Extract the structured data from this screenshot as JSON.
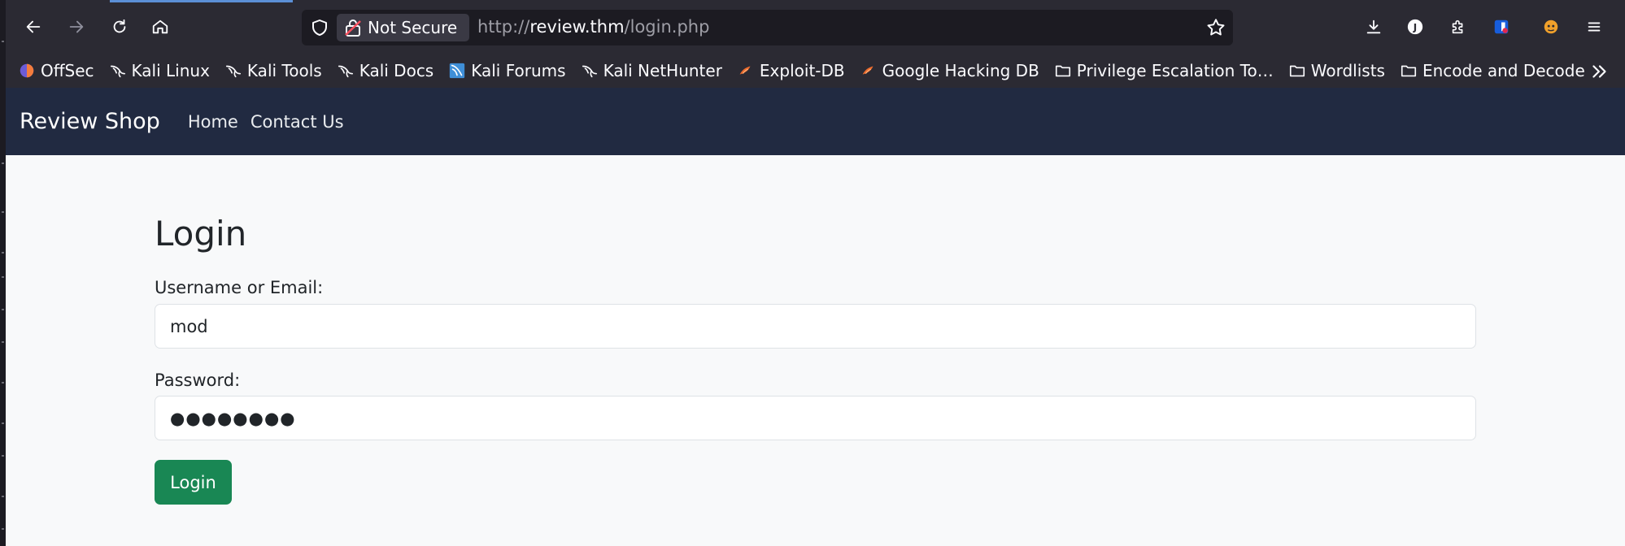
{
  "browser": {
    "not_secure_label": "Not Secure",
    "url_scheme": "http://",
    "url_host": "review.thm",
    "url_path": "/login.php",
    "bookmarks": [
      {
        "label": "OffSec",
        "icon": "offsec-icon"
      },
      {
        "label": "Kali Linux",
        "icon": "kali-dragon-icon"
      },
      {
        "label": "Kali Tools",
        "icon": "kali-dragon-icon"
      },
      {
        "label": "Kali Docs",
        "icon": "kali-dragon-icon"
      },
      {
        "label": "Kali Forums",
        "icon": "kali-forums-icon"
      },
      {
        "label": "Kali NetHunter",
        "icon": "kali-dragon-icon"
      },
      {
        "label": "Exploit-DB",
        "icon": "exploit-db-icon"
      },
      {
        "label": "Google Hacking DB",
        "icon": "exploit-db-icon"
      },
      {
        "label": "Privilege Escalation To…",
        "icon": "folder-icon"
      },
      {
        "label": "Wordlists",
        "icon": "folder-icon"
      },
      {
        "label": "Encode and Decode",
        "icon": "folder-icon"
      }
    ]
  },
  "site": {
    "brand": "Review Shop",
    "nav": [
      {
        "label": "Home"
      },
      {
        "label": "Contact Us"
      }
    ]
  },
  "form": {
    "title": "Login",
    "username_label": "Username or Email:",
    "username_value": "mod",
    "password_label": "Password:",
    "password_value": "●●●●●●●●",
    "submit_label": "Login"
  },
  "colors": {
    "navbar": "#212a41",
    "button": "#198754",
    "browser_chrome": "#2b2a33"
  }
}
